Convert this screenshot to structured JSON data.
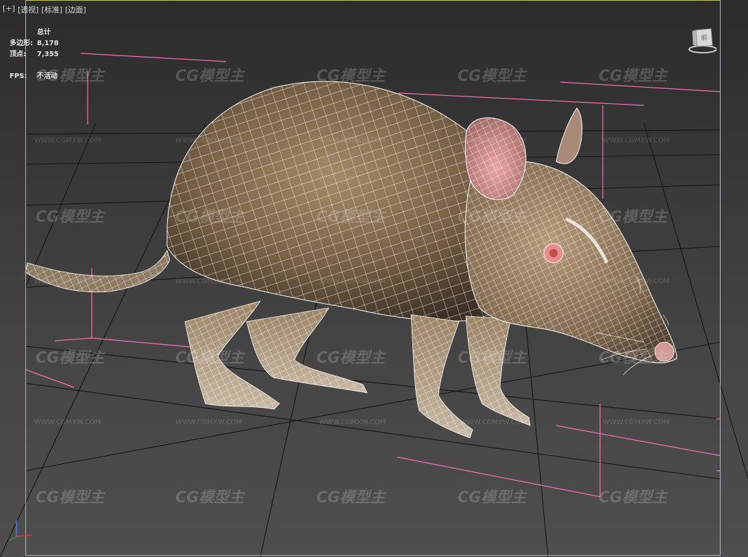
{
  "viewport": {
    "menu": [
      "[+]",
      "[透视]",
      "[标准]",
      "[边面]"
    ]
  },
  "stats": {
    "header": "总计",
    "polygons_label": "多边形:",
    "polygons_value": "8,178",
    "vertices_label": "顶点:",
    "vertices_value": "7,355",
    "fps_label": "FPS:",
    "fps_value": "不活动"
  },
  "watermark": {
    "logo_text": "CG模型主",
    "url_text": "WWW.CGMXW.COM"
  },
  "viewcube": {
    "face_label": "前"
  },
  "colors": {
    "border_active": "#c8c83a",
    "grid": "#111111",
    "bbox": "#ff6fb0",
    "wire": "#ffffff",
    "fur": "#7a6246"
  }
}
